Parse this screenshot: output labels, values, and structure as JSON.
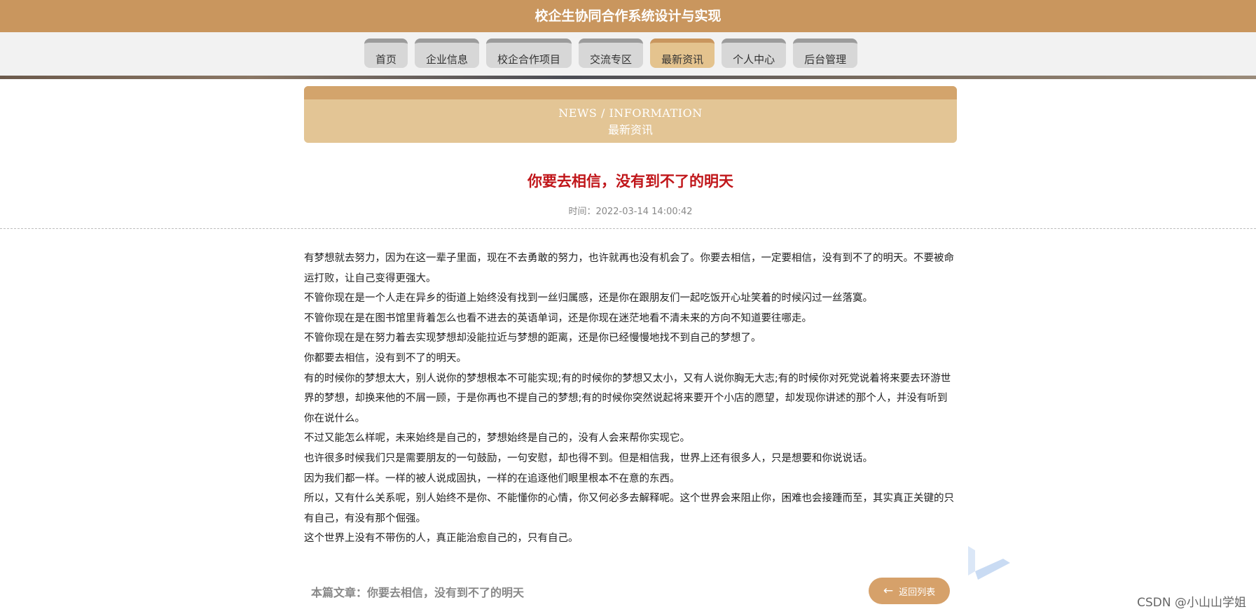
{
  "app": {
    "title": "校企生协同合作系统设计与实现"
  },
  "nav": {
    "items": [
      {
        "label": "首页",
        "active": false
      },
      {
        "label": "企业信息",
        "active": false
      },
      {
        "label": "校企合作项目",
        "active": false
      },
      {
        "label": "交流专区",
        "active": false
      },
      {
        "label": "最新资讯",
        "active": true
      },
      {
        "label": "个人中心",
        "active": false
      },
      {
        "label": "后台管理",
        "active": false
      }
    ]
  },
  "section": {
    "title_en": "NEWS / INFORMATION",
    "title_zh": "最新资讯"
  },
  "article": {
    "title": "你要去相信，没有到不了的明天",
    "time_label": "时间：",
    "time_value": "2022-03-14 14:00:42",
    "paragraphs": [
      "有梦想就去努力，因为在这一辈子里面，现在不去勇敢的努力，也许就再也没有机会了。你要去相信，一定要相信，没有到不了的明天。不要被命运打败，让自己变得更强大。",
      "不管你现在是一个人走在异乡的街道上始终没有找到一丝归属感，还是你在跟朋友们一起吃饭开心址笑着的时候闪过一丝落寞。",
      "不管你现在是在图书馆里背着怎么也看不进去的英语单词，还是你现在迷茫地看不清未来的方向不知道要往哪走。",
      "不管你现在是在努力着去实现梦想却没能拉近与梦想的距离，还是你已经慢慢地找不到自己的梦想了。",
      "你都要去相信，没有到不了的明天。",
      "有的时候你的梦想太大，别人说你的梦想根本不可能实现;有的时候你的梦想又太小，又有人说你胸无大志;有的时候你对死党说着将来要去环游世界的梦想，却换来他的不屑一顾，于是你再也不提自己的梦想;有的时候你突然说起将来要开个小店的愿望，却发现你讲述的那个人，并没有听到你在说什么。",
      "不过又能怎么样呢，未来始终是自己的，梦想始终是自己的，没有人会来帮你实现它。",
      "也许很多时候我们只是需要朋友的一句鼓励，一句安慰，却也得不到。但是相信我，世界上还有很多人，只是想要和你说说话。",
      "因为我们都一样。一样的被人说成固执，一样的在追逐他们眼里根本不在意的东西。",
      "所以，又有什么关系呢，别人始终不是你、不能懂你的心情，你又何必多去解释呢。这个世界会来阻止你，困难也会接踵而至，其实真正关键的只有自己，有没有那个倔强。",
      "这个世界上没有不带伤的人，真正能治愈自己的，只有自己。"
    ]
  },
  "footer": {
    "current_label": "本篇文章：",
    "current_title": "你要去相信，没有到不了的明天",
    "back_label": "返回列表"
  },
  "watermark": "CSDN @小山山学姐",
  "colors": {
    "brand": "#c9965e",
    "title_red": "#c0161a",
    "banner": "#e3c595"
  }
}
